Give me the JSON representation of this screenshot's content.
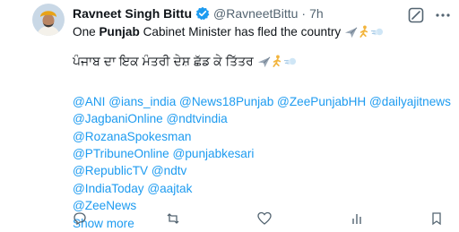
{
  "tweet": {
    "author_name": "Ravneet Singh Bittu",
    "handle": "@RavneetBittu",
    "separator": "·",
    "time": "7h",
    "line1_pre": "One ",
    "line1_bold": "Punjab",
    "line1_post": " Cabinet Minister has fled the country",
    "punjabi_line": "ਪੰਜਾਬ ਦਾ ਇਕ ਮੰਤਰੀ ਦੇਸ਼ ਛੱਡ ਕੇ ਤਿੱਤਰ",
    "mention_lines": [
      "@ANI @ians_india @News18Punjab @ZeePunjabHH @dailyajitnews",
      "@JagbaniOnline @ndtvindia",
      "@RozanaSpokesman",
      "@PTribuneOnline @punjabkesari",
      "@RepublicTV  @ndtv",
      "@IndiaToday @aajtak",
      "@ZeeNews"
    ],
    "show_more": "Show more"
  },
  "icons": {
    "verified": "verified-badge-icon",
    "grok": "grok-icon",
    "more": "more-options-icon",
    "emoji1": "airplane-emoji",
    "emoji2": "running-person-emoji",
    "emoji3": "dash-emoji"
  },
  "actions": {
    "reply": "",
    "repost": "",
    "like": "",
    "views": ""
  },
  "colors": {
    "link": "#1d9bf0",
    "secondary_text": "#536471",
    "verified": "#1d9bf0"
  }
}
